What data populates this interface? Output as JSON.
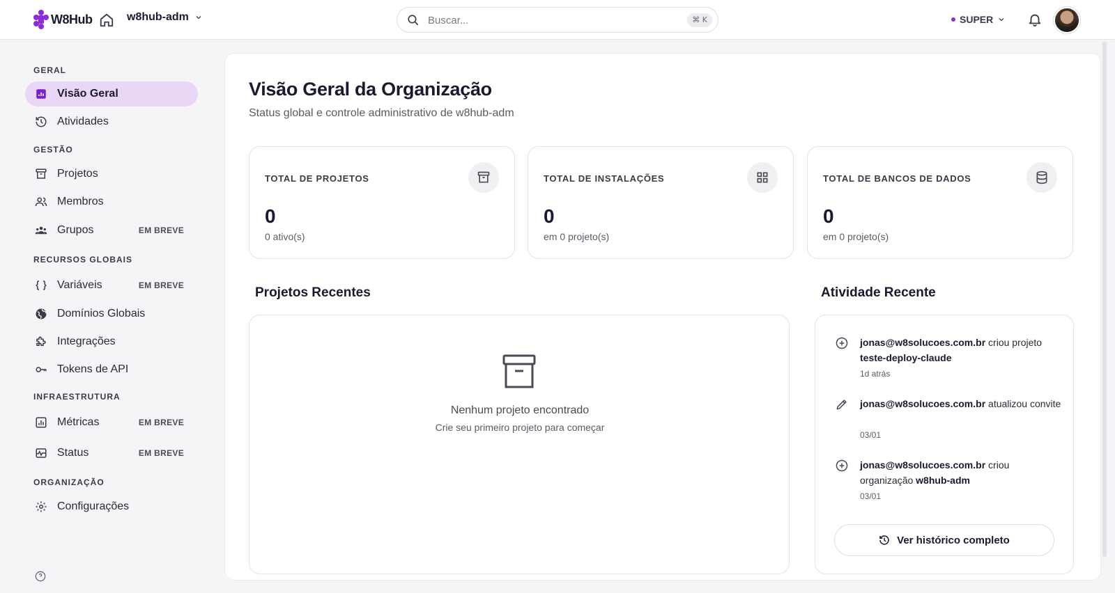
{
  "brand": {
    "name": "W8Hub",
    "accent": "#8b2bd9",
    "active_bg": "#ead7f6"
  },
  "header": {
    "org_name": "w8hub-adm",
    "search_placeholder": "Buscar...",
    "search_shortcut": "⌘ K",
    "role": "SUPER",
    "home_icon": "home-icon",
    "bell_icon": "bell-icon"
  },
  "sidebar": {
    "sections": [
      {
        "title": "GERAL"
      },
      {
        "title": "GESTÃO"
      },
      {
        "title": "RECURSOS GLOBAIS"
      },
      {
        "title": "INFRAESTRUTURA"
      },
      {
        "title": "ORGANIZAÇÃO"
      }
    ],
    "items": [
      {
        "label": "Visão Geral",
        "icon": "chart-icon",
        "active": true,
        "badge": ""
      },
      {
        "label": "Atividades",
        "icon": "history-icon",
        "badge": ""
      },
      {
        "label": "Projetos",
        "icon": "archive-icon",
        "badge": ""
      },
      {
        "label": "Membros",
        "icon": "users-icon",
        "badge": ""
      },
      {
        "label": "Grupos",
        "icon": "group-icon",
        "badge": "EM BREVE"
      },
      {
        "label": "Variáveis",
        "icon": "braces-icon",
        "badge": "EM BREVE"
      },
      {
        "label": "Domínios Globais",
        "icon": "globe-icon",
        "badge": ""
      },
      {
        "label": "Integrações",
        "icon": "puzzle-icon",
        "badge": ""
      },
      {
        "label": "Tokens de API",
        "icon": "key-icon",
        "badge": ""
      },
      {
        "label": "Métricas",
        "icon": "bar-chart-icon",
        "badge": "EM BREVE"
      },
      {
        "label": "Status",
        "icon": "activity-icon",
        "badge": "EM BREVE"
      },
      {
        "label": "Configurações",
        "icon": "gear-icon",
        "badge": ""
      }
    ],
    "help_icon": "help-icon"
  },
  "main": {
    "title": "Visão Geral da Organização",
    "subtitle": "Status global e controle administrativo de w8hub-adm",
    "stats": [
      {
        "label": "TOTAL DE PROJETOS",
        "value": "0",
        "sub": "0 ativo(s)",
        "icon": "archive-icon"
      },
      {
        "label": "TOTAL DE INSTALAÇÕES",
        "value": "0",
        "sub": "em 0 projeto(s)",
        "icon": "grid-icon"
      },
      {
        "label": "TOTAL DE BANCOS DE DADOS",
        "value": "0",
        "sub": "em 0 projeto(s)",
        "icon": "database-icon"
      }
    ],
    "recent_projects": {
      "title": "Projetos Recentes",
      "empty_title": "Nenhum projeto encontrado",
      "empty_sub": "Crie seu primeiro projeto para começar"
    },
    "activity": {
      "title": "Atividade Recente",
      "items": [
        {
          "icon": "plus-circle-icon",
          "user": "jonas@w8solucoes.com.br",
          "action": " criou projeto ",
          "target": "teste-deploy-claude",
          "time": "1d atrás"
        },
        {
          "icon": "pencil-icon",
          "user": "jonas@w8solucoes.com.br",
          "action": " atualizou convite",
          "target": "",
          "time": "03/01"
        },
        {
          "icon": "plus-circle-icon",
          "user": "jonas@w8solucoes.com.br",
          "action": " criou organização ",
          "target": "w8hub-adm",
          "time": "03/01"
        }
      ],
      "history_button": "Ver histórico completo"
    }
  }
}
